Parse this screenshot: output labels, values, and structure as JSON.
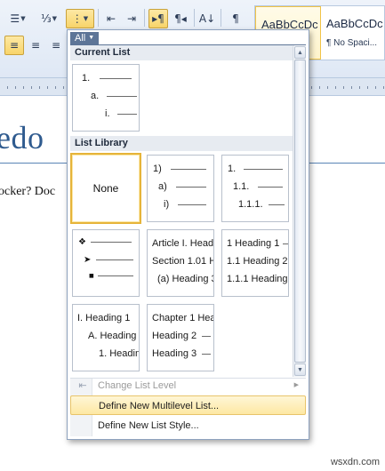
{
  "toolbar": {
    "row1": [
      {
        "name": "bullets-button",
        "glyph": "☰"
      },
      {
        "name": "numbering-button",
        "glyph": "⅓"
      },
      {
        "name": "multilevel-list-button",
        "glyph": "⋮"
      },
      {
        "name": "decrease-indent-button",
        "glyph": "⇤"
      },
      {
        "name": "increase-indent-button",
        "glyph": "⇥"
      },
      {
        "name": "ltr-button",
        "glyph": "▸¶"
      },
      {
        "name": "rtl-button",
        "glyph": "¶◂"
      },
      {
        "name": "sort-button",
        "glyph": "A↓"
      },
      {
        "name": "show-marks-button",
        "glyph": "¶"
      }
    ],
    "align_left_glyph": "≡",
    "align_center_glyph": "≡",
    "align_right_glyph": "≡"
  },
  "styles": {
    "normal_sample": "AaBbCcDc",
    "nospacing_sample": "AaBbCcDc",
    "nospacing_name": "¶ No Spaci..."
  },
  "document": {
    "heading_fragment": "edo",
    "body_fragment": "ocker? Doc",
    "watermark": "wsxdn.com"
  },
  "dropdown": {
    "filter_label": "All",
    "current_list_header": "Current List",
    "list_library_header": "List Library",
    "current_list": [
      "1.",
      "a.",
      "i."
    ],
    "none_label": "None",
    "library": [
      {
        "rows": [
          "1)",
          "a)",
          "i)"
        ]
      },
      {
        "rows": [
          "1.",
          "1.1.",
          "1.1.1."
        ]
      },
      {
        "rows": [
          "❖",
          "➤",
          "■"
        ]
      },
      {
        "rows": [
          "Article I. Headi",
          "Section 1.01 H",
          "(a) Heading 3"
        ]
      },
      {
        "rows": [
          "1 Heading 1",
          "1.1 Heading 2",
          "1.1.1 Heading"
        ]
      },
      {
        "rows": [
          "I. Heading 1",
          "A. Heading 2",
          "1. Headin"
        ]
      },
      {
        "rows": [
          "Chapter 1 Hea",
          "Heading 2",
          "Heading 3"
        ]
      }
    ],
    "menu": {
      "change_level": "Change List Level",
      "define_multilevel": "Define New Multilevel List...",
      "define_style": "Define New List Style..."
    }
  }
}
